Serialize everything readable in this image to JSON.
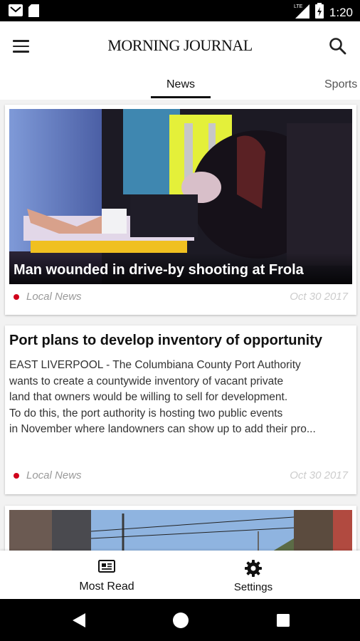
{
  "status_bar": {
    "time": "1:20",
    "network": "LTE",
    "left_icons": [
      "mail-icon",
      "sd-card-icon"
    ],
    "right_icons": [
      "signal-icon",
      "battery-icon"
    ]
  },
  "app_bar": {
    "logo": "Morning Journal",
    "menu_icon": "menu-icon",
    "search_icon": "search-icon"
  },
  "tabs": [
    {
      "label": "News",
      "active": true
    },
    {
      "label": "Sports",
      "active": false
    }
  ],
  "articles": [
    {
      "headline": "Man wounded in drive-by shooting at Frola",
      "category": "Local News",
      "date": "Oct 30 2017"
    },
    {
      "headline": "Port plans to develop inventory of opportunity",
      "excerpt_lines": [
        "EAST LIVERPOOL - The Columbiana County Port Authority",
        "wants to create a countywide inventory of vacant private",
        "land that owners would be willing to sell for development.",
        "To do this, the port authority is hosting two public events",
        "in November where landowners can show up to add their pro..."
      ],
      "category": "Local News",
      "date": "Oct 30 2017"
    }
  ],
  "bottom_nav": {
    "most_read": "Most Read",
    "settings": "Settings"
  },
  "colors": {
    "accent_dot": "#d0021b",
    "active_tab": "#111111"
  }
}
